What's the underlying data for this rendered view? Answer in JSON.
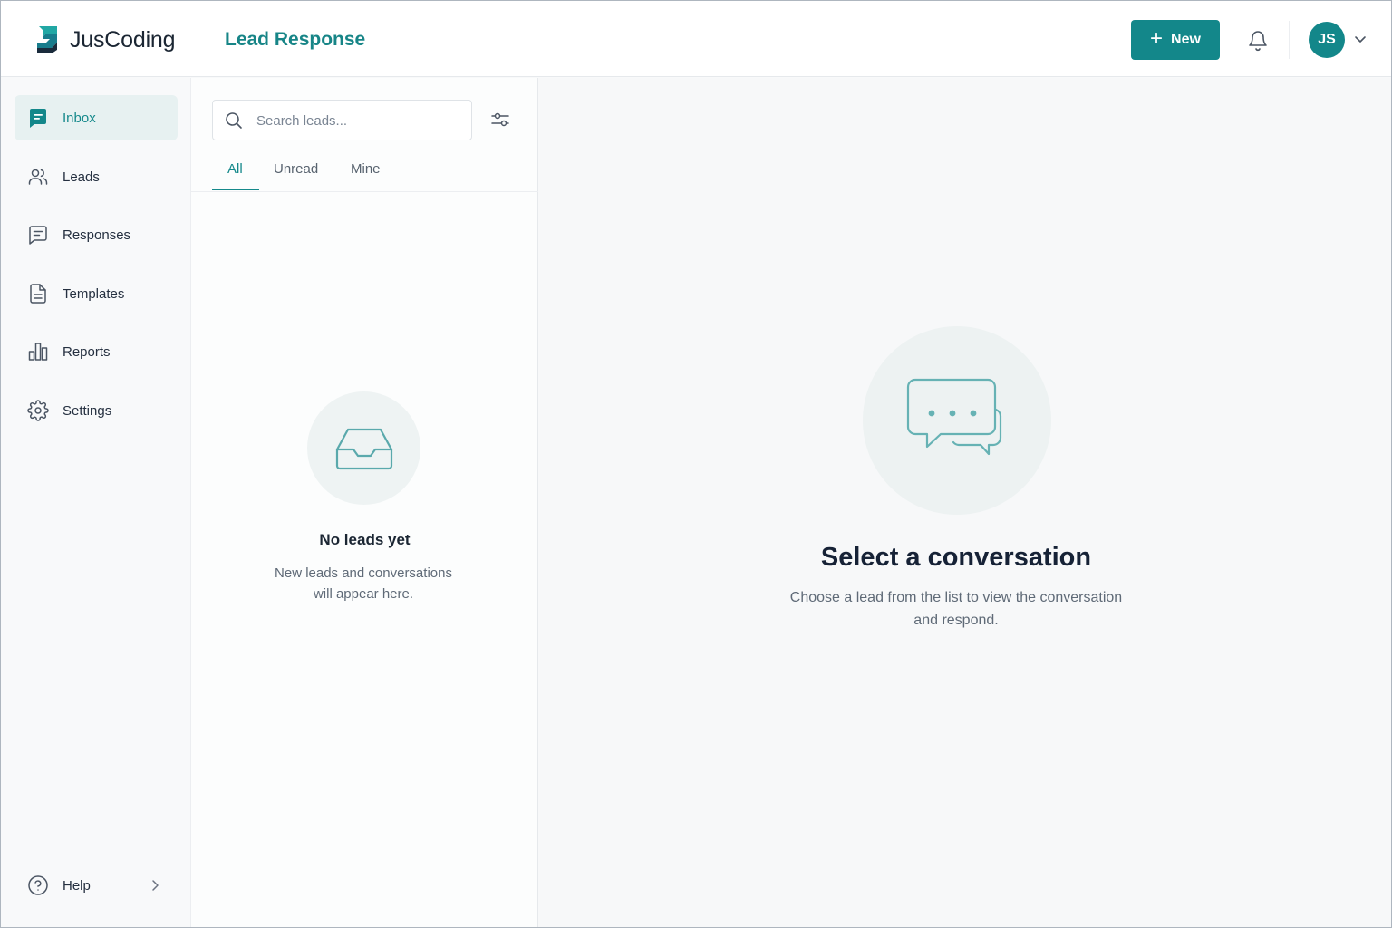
{
  "header": {
    "brand": "JusCoding",
    "app_title": "Lead Response",
    "new_button": "New",
    "avatar_initials": "JS"
  },
  "sidebar": {
    "items": [
      {
        "label": "Inbox",
        "icon": "inbox-chat-icon",
        "active": true
      },
      {
        "label": "Leads",
        "icon": "users-icon",
        "active": false
      },
      {
        "label": "Responses",
        "icon": "message-square-icon",
        "active": false
      },
      {
        "label": "Templates",
        "icon": "document-icon",
        "active": false
      },
      {
        "label": "Reports",
        "icon": "bar-chart-icon",
        "active": false
      },
      {
        "label": "Settings",
        "icon": "gear-icon",
        "active": false
      }
    ],
    "help": {
      "label": "Help",
      "icon": "help-circle-icon"
    }
  },
  "list": {
    "search_placeholder": "Search leads...",
    "search_value": "",
    "tabs": [
      {
        "label": "All",
        "active": true
      },
      {
        "label": "Unread",
        "active": false
      },
      {
        "label": "Mine",
        "active": false
      }
    ],
    "empty_title": "No leads yet",
    "empty_desc_line1": "New leads and conversations",
    "empty_desc_line2": "will appear here."
  },
  "main": {
    "title": "Select a conversation",
    "desc_line1": "Choose a lead from the list to view the conversation",
    "desc_line2": "and respond."
  },
  "colors": {
    "accent": "#13878a",
    "active_bg": "#e7f1f1",
    "text_dark": "#1b2633",
    "text_muted": "#5f6a77"
  }
}
